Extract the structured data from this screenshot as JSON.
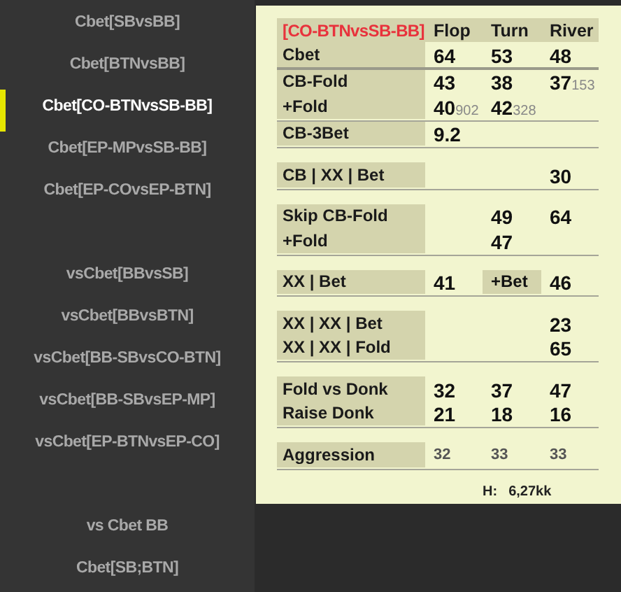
{
  "sidebar": {
    "groups": [
      {
        "items": [
          {
            "label": "Cbet[SBvsBB]",
            "selected": false
          },
          {
            "label": "Cbet[BTNvsBB]",
            "selected": false
          },
          {
            "label": "Cbet[CO-BTNvsSB-BB]",
            "selected": true
          },
          {
            "label": "Cbet[EP-MPvsSB-BB]",
            "selected": false
          },
          {
            "label": "Cbet[EP-COvsEP-BTN]",
            "selected": false
          }
        ]
      },
      {
        "items": [
          {
            "label": "vsCbet[BBvsSB]",
            "selected": false
          },
          {
            "label": "vsCbet[BBvsBTN]",
            "selected": false
          },
          {
            "label": "vsCbet[BB-SBvsCO-BTN]",
            "selected": false
          },
          {
            "label": "vsCbet[BB-SBvsEP-MP]",
            "selected": false
          },
          {
            "label": "vsCbet[EP-BTNvsEP-CO]",
            "selected": false
          }
        ]
      },
      {
        "items": [
          {
            "label": "vs Cbet BB",
            "selected": false
          },
          {
            "label": "Cbet[SB;BTN]",
            "selected": false
          }
        ]
      }
    ]
  },
  "stats": {
    "title": "[CO-BTNvsSB-BB]",
    "columns": [
      "Flop",
      "Turn",
      "River"
    ],
    "blocks": [
      {
        "sections": [
          {
            "thick_rule": true,
            "rows": [
              {
                "kind": "stat",
                "label": "Cbet",
                "cells": [
                  {
                    "value": "64"
                  },
                  {
                    "value": "53"
                  },
                  {
                    "value": "48"
                  }
                ]
              }
            ]
          },
          {
            "thick_rule": false,
            "rows": [
              {
                "kind": "stat",
                "label": "CB-Fold",
                "cells": [
                  {
                    "value": "43"
                  },
                  {
                    "value": "38"
                  },
                  {
                    "value": "37",
                    "sub": "153"
                  }
                ]
              },
              {
                "kind": "stat",
                "label": "+Fold",
                "cells": [
                  {
                    "value": "40",
                    "sub": "902"
                  },
                  {
                    "value": "42",
                    "sub": "328"
                  },
                  {}
                ]
              }
            ]
          },
          {
            "thick_rule": false,
            "rows": [
              {
                "kind": "stat",
                "label": "CB-3Bet",
                "cells": [
                  {
                    "value": "9.2"
                  },
                  {},
                  {}
                ]
              }
            ]
          }
        ]
      },
      {
        "sections": [
          {
            "thick_rule": false,
            "rows": [
              {
                "kind": "stat",
                "label": "CB | XX | Bet",
                "cells": [
                  {},
                  {},
                  {
                    "value": "30"
                  }
                ]
              }
            ]
          }
        ]
      },
      {
        "sections": [
          {
            "thick_rule": false,
            "rows": [
              {
                "kind": "stat",
                "label": "Skip CB-Fold",
                "cells": [
                  {},
                  {
                    "value": "49"
                  },
                  {
                    "value": "64"
                  }
                ]
              },
              {
                "kind": "stat",
                "label": "+Fold",
                "cells": [
                  {},
                  {
                    "value": "47"
                  },
                  {}
                ]
              }
            ]
          }
        ]
      },
      {
        "sections": [
          {
            "thick_rule": false,
            "rows": [
              {
                "kind": "stat",
                "label": "XX | Bet",
                "cells": [
                  {
                    "value": "41"
                  },
                  {
                    "value": "+Bet",
                    "kind": "label"
                  },
                  {
                    "value": "46"
                  }
                ]
              }
            ]
          }
        ]
      },
      {
        "sections": [
          {
            "thick_rule": false,
            "rows": [
              {
                "kind": "stat",
                "label": "XX | XX | Bet",
                "cells": [
                  {},
                  {},
                  {
                    "value": "23"
                  }
                ]
              },
              {
                "kind": "stat",
                "label": "XX | XX | Fold",
                "cells": [
                  {},
                  {},
                  {
                    "value": "65"
                  }
                ]
              }
            ]
          }
        ]
      },
      {
        "sections": [
          {
            "thick_rule": false,
            "rows": [
              {
                "kind": "stat",
                "label": "Fold vs Donk",
                "cells": [
                  {
                    "value": "32"
                  },
                  {
                    "value": "37"
                  },
                  {
                    "value": "47"
                  }
                ]
              },
              {
                "kind": "stat",
                "label": "Raise Donk",
                "cells": [
                  {
                    "value": "21"
                  },
                  {
                    "value": "18"
                  },
                  {
                    "value": "16"
                  }
                ]
              }
            ]
          }
        ]
      },
      {
        "sections": [
          {
            "thick_rule": false,
            "rows": [
              {
                "kind": "minor",
                "label": "Aggression",
                "cells": [
                  {
                    "value": "32"
                  },
                  {
                    "value": "33"
                  },
                  {
                    "value": "33"
                  }
                ]
              }
            ]
          }
        ]
      }
    ],
    "footer": {
      "label": "H:",
      "value": "6,27kk"
    }
  }
}
